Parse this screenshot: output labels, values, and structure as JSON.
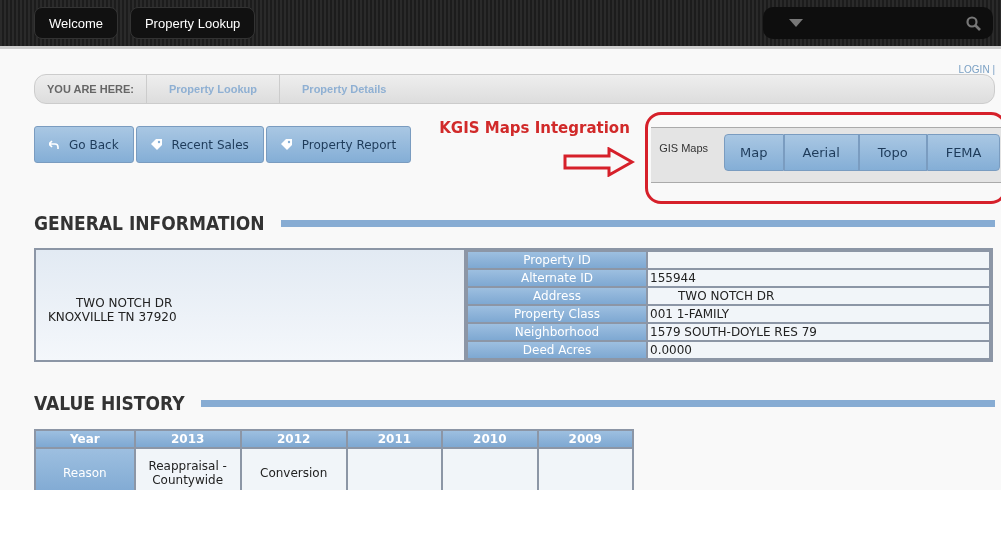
{
  "top_nav": {
    "tabs": [
      {
        "label": "Welcome"
      },
      {
        "label": "Property Lookup"
      }
    ]
  },
  "login_link": "LOGIN |",
  "breadcrumb": {
    "label": "YOU ARE HERE:",
    "items": [
      "Property Lookup",
      "Property Details"
    ]
  },
  "actions": [
    {
      "label": "Go Back",
      "kind": "back"
    },
    {
      "label": "Recent Sales",
      "kind": "tag"
    },
    {
      "label": "Property Report",
      "kind": "tag"
    }
  ],
  "annotation": "KGIS Maps Integration",
  "gis_maps": {
    "label": "GIS Maps",
    "buttons": [
      "Map",
      "Aerial",
      "Topo",
      "FEMA"
    ]
  },
  "general_information": {
    "title": "GENERAL INFORMATION",
    "owner_address": [
      "TWO NOTCH DR",
      "KNOXVILLE TN 37920"
    ],
    "fields": [
      {
        "label": "Property ID"
      },
      {
        "label": "Alternate ID",
        "value": "155944"
      },
      {
        "label": "Address",
        "value": "TWO NOTCH DR"
      },
      {
        "label": "Property Class",
        "value": "001 1-FAMILY"
      },
      {
        "label": "Neighborhood",
        "value": "1579 SOUTH-DOYLE RES 79"
      },
      {
        "label": "Deed Acres",
        "value": "0.0000"
      }
    ]
  },
  "value_history": {
    "title": "VALUE HISTORY",
    "columns": [
      "Year",
      "2013",
      "2012",
      "2011",
      "2010",
      "2009"
    ],
    "rows": [
      {
        "cells": [
          "Reason",
          "Reappraisal - Countywide",
          "Conversion",
          "",
          "",
          ""
        ]
      }
    ]
  }
}
